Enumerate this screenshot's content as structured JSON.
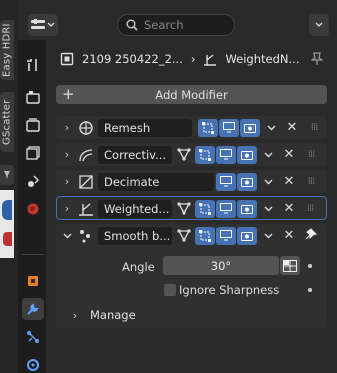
{
  "window": {
    "size_note": ""
  },
  "left_tabs": [
    {
      "label": "Easy HDRI"
    },
    {
      "label": "GScatter"
    }
  ],
  "header": {
    "search_placeholder": "Search",
    "search_icon": "search-icon"
  },
  "breadcrumb": {
    "object": "2109 250422_2...",
    "modifier": "WeightedN..."
  },
  "add_modifier": {
    "label": "Add Modifier"
  },
  "modifiers": [
    {
      "name": "Remesh",
      "icon": "remesh-icon",
      "has_cage": false,
      "has_edit": true,
      "selected": false
    },
    {
      "name": "Correctiv...",
      "icon": "corrective-smooth-icon",
      "has_cage": true,
      "has_edit": true,
      "selected": false
    },
    {
      "name": "Decimate",
      "icon": "decimate-icon",
      "has_cage": false,
      "has_edit": false,
      "selected": false
    },
    {
      "name": "Weighted...",
      "icon": "weighted-normal-icon",
      "has_cage": true,
      "has_edit": true,
      "selected": true
    },
    {
      "name": "Smooth b...",
      "icon": "smooth-by-angle-icon",
      "has_cage": true,
      "has_edit": true,
      "selected": false,
      "expanded": true
    }
  ],
  "smooth_by_angle": {
    "angle_label": "Angle",
    "angle_value": "30°",
    "ignore_sharpness_label": "Ignore Sharpness",
    "ignore_sharpness_checked": false,
    "manage_label": "Manage"
  },
  "colors": {
    "accent": "#4772b3",
    "panel": "#2a2a2a",
    "field": "#545454"
  }
}
